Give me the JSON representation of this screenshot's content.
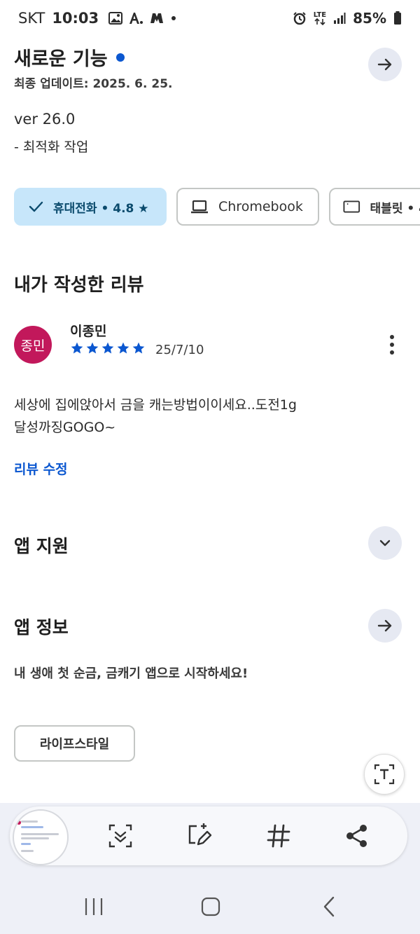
{
  "status_bar": {
    "carrier": "SKT",
    "time": "10:03",
    "network": "LTE",
    "battery": "85%"
  },
  "whats_new": {
    "title": "새로운 기능",
    "updated": "최종 업데이트: 2025. 6. 25.",
    "version": "ver 26.0",
    "notes": "- 최적화 작업"
  },
  "device_chips": [
    {
      "label": "휴대전화 • 4.8 ★",
      "selected": true,
      "icon": "check-icon"
    },
    {
      "label": "Chromebook",
      "selected": false,
      "icon": "laptop-icon"
    },
    {
      "label": "태블릿 • 4",
      "selected": false,
      "icon": "tablet-icon"
    }
  ],
  "my_review": {
    "title": "내가 작성한 리뷰",
    "avatar_text": "종민",
    "avatar_color": "#c2185b",
    "reviewer": "이종민",
    "rating": 5,
    "date": "25/7/10",
    "text_line1": "세상에 집에앉아서 금을 캐는방법이이세요..도전1g",
    "text_line2": "달성까징GOGO~",
    "edit_label": "리뷰 수정"
  },
  "app_support": {
    "title": "앱 지원"
  },
  "app_info": {
    "title": "앱 정보",
    "description": "내 생애 첫 순금, 금캐기 앱으로 시작하세요!",
    "category": "라이프스타일"
  },
  "colors": {
    "accent": "#0b57d0",
    "star": "#0b57d0",
    "chip_selected_bg": "#c7e6fa"
  },
  "toolbar_icons": [
    "capture-scroll-icon",
    "edit-icon",
    "tag-icon",
    "share-icon"
  ],
  "nav_icons": [
    "recents-icon",
    "home-icon",
    "back-icon"
  ]
}
